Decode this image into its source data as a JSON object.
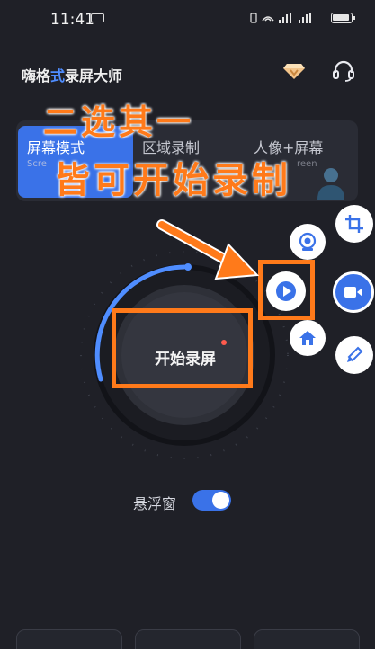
{
  "status_bar": {
    "time": "11:41",
    "right_indicators": "🔋⁴ᴳ ⁴ᴳ"
  },
  "header": {
    "app_title_part1": "嗨格",
    "app_title_part2": "式",
    "app_title_part3": "录屏",
    "app_title_part4": "大师",
    "vip_icon": "diamond-icon",
    "support_icon": "headset-icon"
  },
  "modes": {
    "tabs": [
      {
        "label": "屏幕模式",
        "sub": "Scre"
      },
      {
        "label": "区域录制",
        "sub": ""
      },
      {
        "label": "人像+屏幕",
        "sub": "reen"
      }
    ],
    "active_index": 0
  },
  "annotation": {
    "line1": "二选其一",
    "line2": "皆可开始录制"
  },
  "record": {
    "label": "开始录屏"
  },
  "floating_window": {
    "label": "悬浮窗",
    "enabled": true
  },
  "colors": {
    "accent": "#3a72e8",
    "annotation": "#ff7a1a",
    "background": "#1f2027"
  }
}
